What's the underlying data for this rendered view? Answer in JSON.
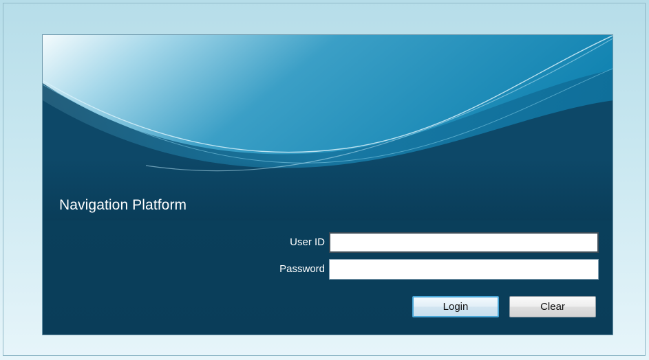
{
  "login": {
    "title": "Navigation Platform",
    "user_id": {
      "label": "User ID",
      "value": "",
      "placeholder": ""
    },
    "password": {
      "label": "Password",
      "value": "",
      "placeholder": ""
    },
    "login_button": "Login",
    "clear_button": "Clear"
  },
  "colors": {
    "panel_dark": "#0a3d59",
    "panel_top": "#2c7fa1",
    "page_background": "#c8e7f0",
    "button_focus_border": "#49a7d8"
  }
}
